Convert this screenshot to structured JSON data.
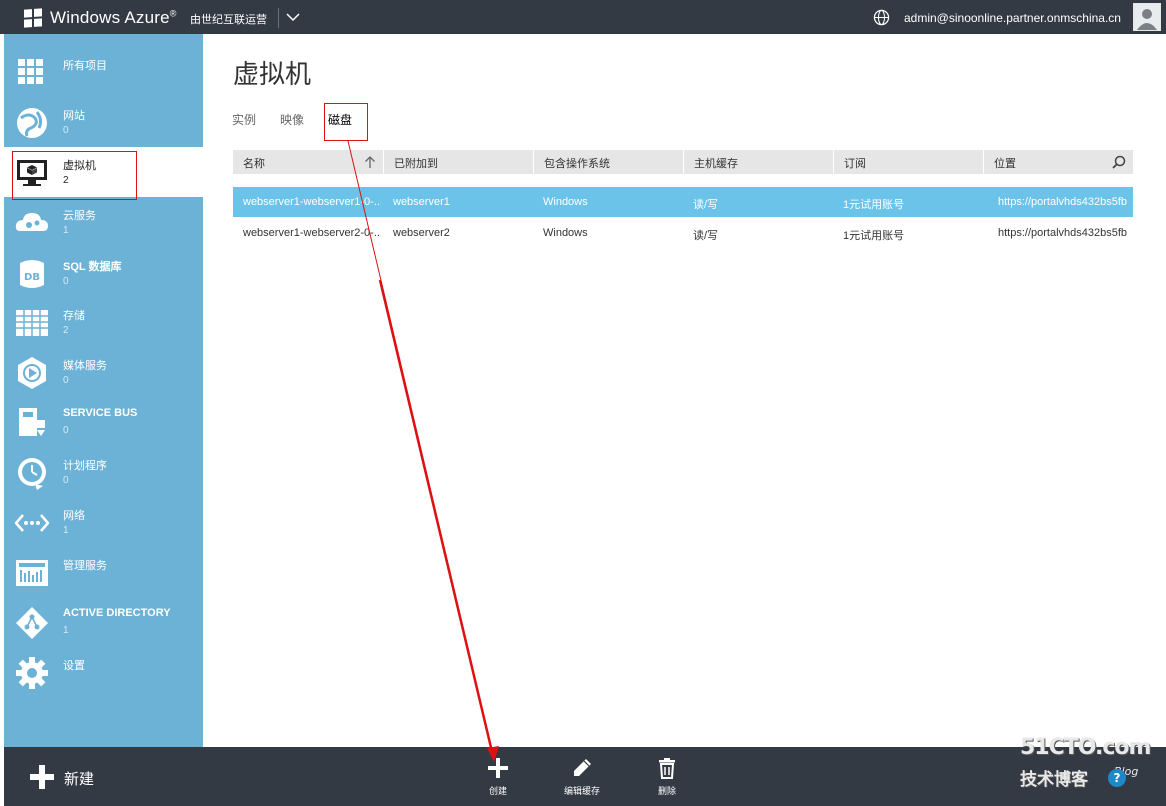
{
  "topbar": {
    "brand": "Windows Azure",
    "brand_mark": "®",
    "tenant": "由世纪互联运营",
    "account": "admin@sinoonline.partner.onmschina.cn"
  },
  "sidebar": {
    "items": [
      {
        "label": "所有项目",
        "count": "",
        "icon": "grid-icon"
      },
      {
        "label": "网站",
        "count": "0",
        "icon": "website-globe-icon"
      },
      {
        "label": "虚拟机",
        "count": "2",
        "icon": "virtual-machine-icon"
      },
      {
        "label": "云服务",
        "count": "1",
        "icon": "cloud-service-icon"
      },
      {
        "label": "SQL 数据库",
        "count": "0",
        "icon": "database-icon"
      },
      {
        "label": "存储",
        "count": "2",
        "icon": "storage-table-icon"
      },
      {
        "label": "媒体服务",
        "count": "0",
        "icon": "media-play-icon"
      },
      {
        "label": "SERVICE BUS",
        "count": "0",
        "icon": "service-bus-icon"
      },
      {
        "label": "计划程序",
        "count": "0",
        "icon": "scheduler-clock-icon"
      },
      {
        "label": "网络",
        "count": "1",
        "icon": "network-arrows-icon"
      },
      {
        "label": "管理服务",
        "count": "",
        "icon": "management-services-icon"
      },
      {
        "label": "ACTIVE DIRECTORY",
        "count": "1",
        "icon": "active-directory-icon"
      },
      {
        "label": "设置",
        "count": "",
        "icon": "gear-icon"
      }
    ]
  },
  "main": {
    "title": "虚拟机",
    "tabs": [
      {
        "label": "实例"
      },
      {
        "label": "映像"
      },
      {
        "label": "磁盘"
      }
    ],
    "columns": [
      "名称",
      "已附加到",
      "包含操作系统",
      "主机缓存",
      "订阅",
      "位置"
    ],
    "rows": [
      {
        "name": "webserver1-webserver1-0-...",
        "attached": "webserver1",
        "os": "Windows",
        "cache": "读/写",
        "subscription": "1元试用账号",
        "location": "https://portalvhds432bs5fb"
      },
      {
        "name": "webserver1-webserver2-0-...",
        "attached": "webserver2",
        "os": "Windows",
        "cache": "读/写",
        "subscription": "1元试用账号",
        "location": "https://portalvhds432bs5fb"
      }
    ]
  },
  "cmdbar": {
    "new_label": "新建",
    "commands": [
      {
        "label": "创建",
        "icon": "plus-icon"
      },
      {
        "label": "编辑缓存",
        "icon": "pencil-icon"
      },
      {
        "label": "删除",
        "icon": "trash-icon"
      }
    ]
  },
  "watermark": {
    "line1": "51CTO.com",
    "line2": "技术博客",
    "line3": "Blog"
  },
  "colors": {
    "topbar": "#333a44",
    "sidebar": "#6bb2d6",
    "selected_row": "#6cc3ea",
    "annotation": "#dd1111"
  }
}
